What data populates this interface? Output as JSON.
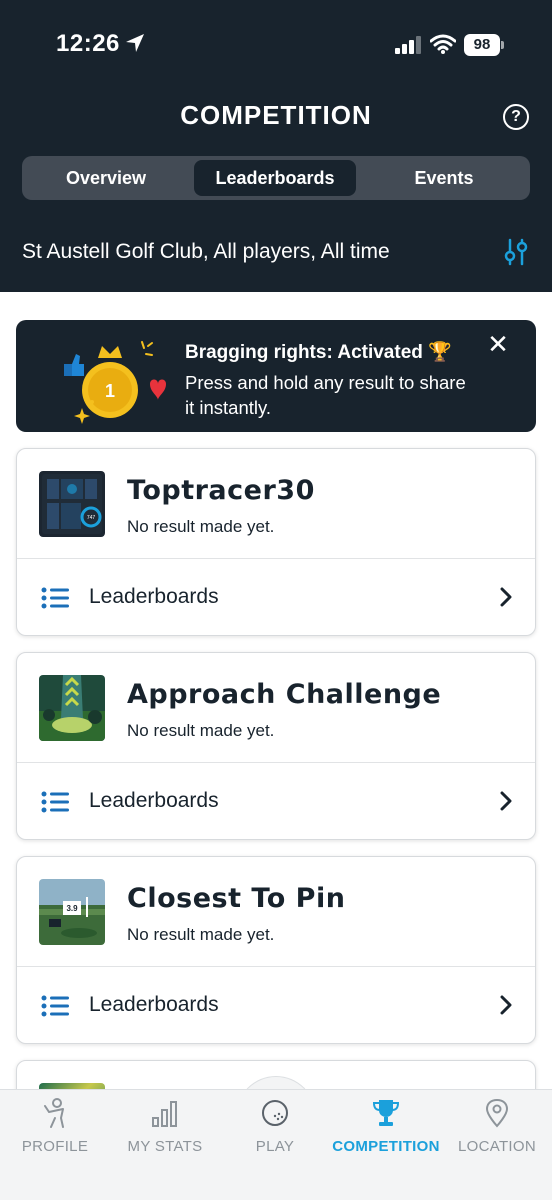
{
  "status_bar": {
    "time": "12:26",
    "battery": "98"
  },
  "header": {
    "title": "COMPETITION",
    "tabs": [
      "Overview",
      "Leaderboards",
      "Events"
    ],
    "filter_text": "St Austell Golf Club, All players, All time"
  },
  "banner": {
    "title": "Bragging rights: Activated 🏆",
    "text": "Press and hold any result to share it instantly.",
    "medal_number": "1"
  },
  "cards": [
    {
      "title": "Toptracer30",
      "subtitle": "No result made yet.",
      "link": "Leaderboards",
      "thumb_text": "747"
    },
    {
      "title": "Approach Challenge",
      "subtitle": "No result made yet.",
      "link": "Leaderboards"
    },
    {
      "title": "Closest To Pin",
      "subtitle": "No result made yet.",
      "link": "Leaderboards",
      "thumb_text": "3.9"
    }
  ],
  "tabbar": {
    "items": [
      "PROFILE",
      "MY STATS",
      "PLAY",
      "COMPETITION",
      "LOCATION"
    ],
    "active": "COMPETITION"
  },
  "colors": {
    "header_bg": "#18232d",
    "accent": "#1ba0db",
    "card_border": "#d7dadd"
  }
}
